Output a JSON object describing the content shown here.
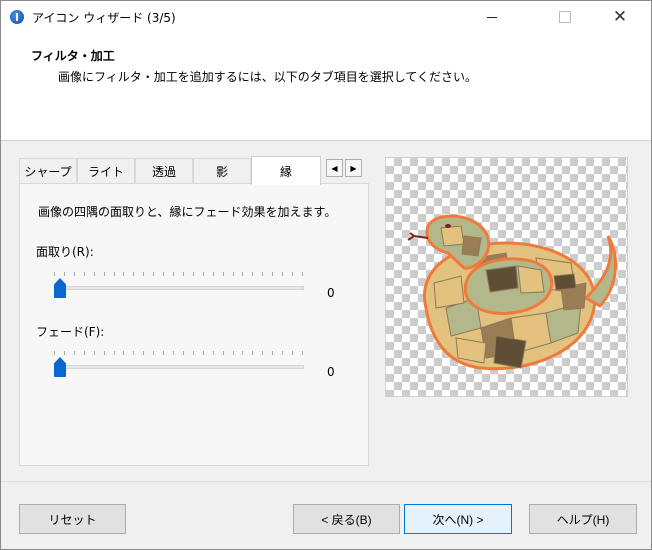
{
  "window": {
    "title": "アイコン ウィザード (3/5)"
  },
  "header": {
    "title": "フィルタ・加工",
    "description": "画像にフィルタ・加工を追加するには、以下のタブ項目を選択してください。"
  },
  "tabs": [
    {
      "label": "シャープ",
      "active": false
    },
    {
      "label": "ライト",
      "active": false
    },
    {
      "label": "透過",
      "active": false
    },
    {
      "label": "影",
      "active": false
    },
    {
      "label": "縁",
      "active": true
    }
  ],
  "panel": {
    "description": "画像の四隅の面取りと、縁にフェード効果を加えます。",
    "chamfer": {
      "label": "面取り(R):",
      "value": "0",
      "level": 0
    },
    "fade": {
      "label": "フェード(F):",
      "value": "0",
      "level": 0
    }
  },
  "preview": {
    "description": "",
    "colors": {
      "outline": "#f07a3c",
      "light": "#e3c17e",
      "sage": "#b3b88a",
      "mid": "#9b7d55",
      "dark": "#5e4e35",
      "eye": "#7a2222"
    }
  },
  "buttons": {
    "reset": "リセット",
    "back": "< 戻る(B)",
    "next": "次へ(N) >",
    "help": "ヘルプ(H)"
  },
  "icons": [
    "app-info-icon",
    "minimize-icon",
    "maximize-icon",
    "close-icon",
    "tab-left-icon",
    "tab-right-icon"
  ]
}
